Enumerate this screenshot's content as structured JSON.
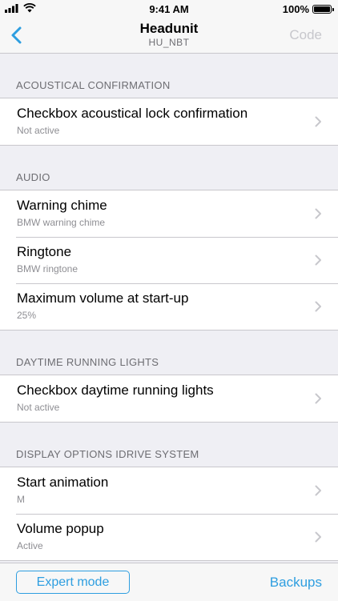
{
  "status_bar": {
    "time": "9:41 AM",
    "battery": "100%"
  },
  "nav": {
    "title": "Headunit",
    "subtitle": "HU_NBT",
    "right_button": "Code",
    "back_icon": "chevron-left-icon"
  },
  "sections": [
    {
      "header": "ACOUSTICAL CONFIRMATION",
      "rows": [
        {
          "title": "Checkbox acoustical lock confirmation",
          "value": "Not active"
        }
      ]
    },
    {
      "header": "AUDIO",
      "rows": [
        {
          "title": "Warning chime",
          "value": "BMW warning chime"
        },
        {
          "title": "Ringtone",
          "value": "BMW ringtone"
        },
        {
          "title": "Maximum volume at start-up",
          "value": "25%"
        }
      ]
    },
    {
      "header": "DAYTIME RUNNING LIGHTS",
      "rows": [
        {
          "title": "Checkbox daytime running lights",
          "value": "Not active"
        }
      ]
    },
    {
      "header": "DISPLAY OPTIONS IDRIVE SYSTEM",
      "rows": [
        {
          "title": "Start animation",
          "value": "M"
        },
        {
          "title": "Volume popup",
          "value": "Active"
        }
      ]
    }
  ],
  "bottom_bar": {
    "expert_mode": "Expert mode",
    "backups": "Backups"
  },
  "colors": {
    "accent": "#2e9ee0",
    "background": "#efeff4",
    "disabled": "#c7c7cc"
  }
}
